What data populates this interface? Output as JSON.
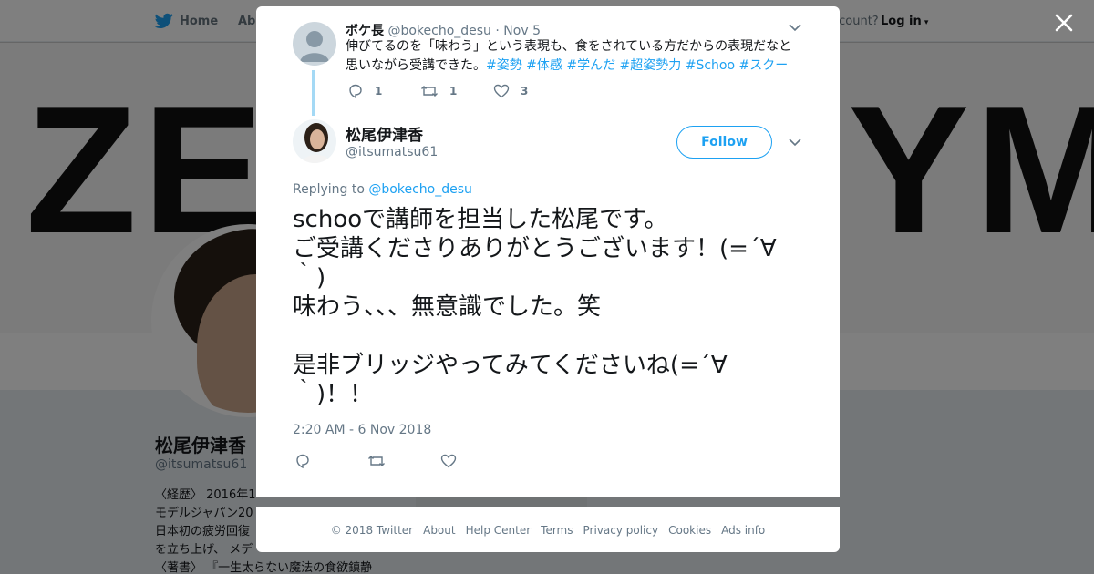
{
  "background": {
    "nav": {
      "home": "Home",
      "about": "Abo",
      "account": "account?",
      "login": "Log in"
    },
    "header_text_left": "ZE",
    "header_text_right": "YM",
    "profile_name": "松尾伊津香",
    "profile_handle": "@itsumatsu61",
    "bio_lines": [
      "〈経歴〉 2016年1",
      "モデルジャパン20",
      "日本初の疲労回復",
      "を立ち上げ、 メデ",
      "〈著書〉 『一生太らない魔法の食欲鎮静"
    ]
  },
  "parent_tweet": {
    "name": "ボケ長",
    "handle": "@bokecho_desu",
    "date": "· Nov 5",
    "text": "伸びてるのを「味わう」という表現も、食をされている方だからの表現だなと思いながら受講できた。",
    "hashtags": "#姿勢 #体感 #学んだ #超姿勢力 #Schoo #スクー",
    "replies": "1",
    "retweets": "1",
    "likes": "3"
  },
  "main_tweet": {
    "name": "松尾伊津香",
    "handle": "@itsumatsu61",
    "follow_label": "Follow",
    "replying_prefix": "Replying to",
    "replying_to": "@bokecho_desu",
    "text": "schooで講師を担当した松尾です。\nご受講くださりありがとうございます！(=´∀\n｀)\n味わう、、、無意識でした。笑\n\n是非ブリッジやってみてくださいね(=´∀\n｀)！！",
    "timestamp": "2:20 AM - 6 Nov 2018"
  },
  "footer": {
    "links": [
      "© 2018 Twitter",
      "About",
      "Help Center",
      "Terms",
      "Privacy policy",
      "Cookies",
      "Ads info"
    ]
  },
  "colors": {
    "accent": "#1da1f2",
    "thread": "#a4d9f5",
    "muted": "#657786"
  }
}
